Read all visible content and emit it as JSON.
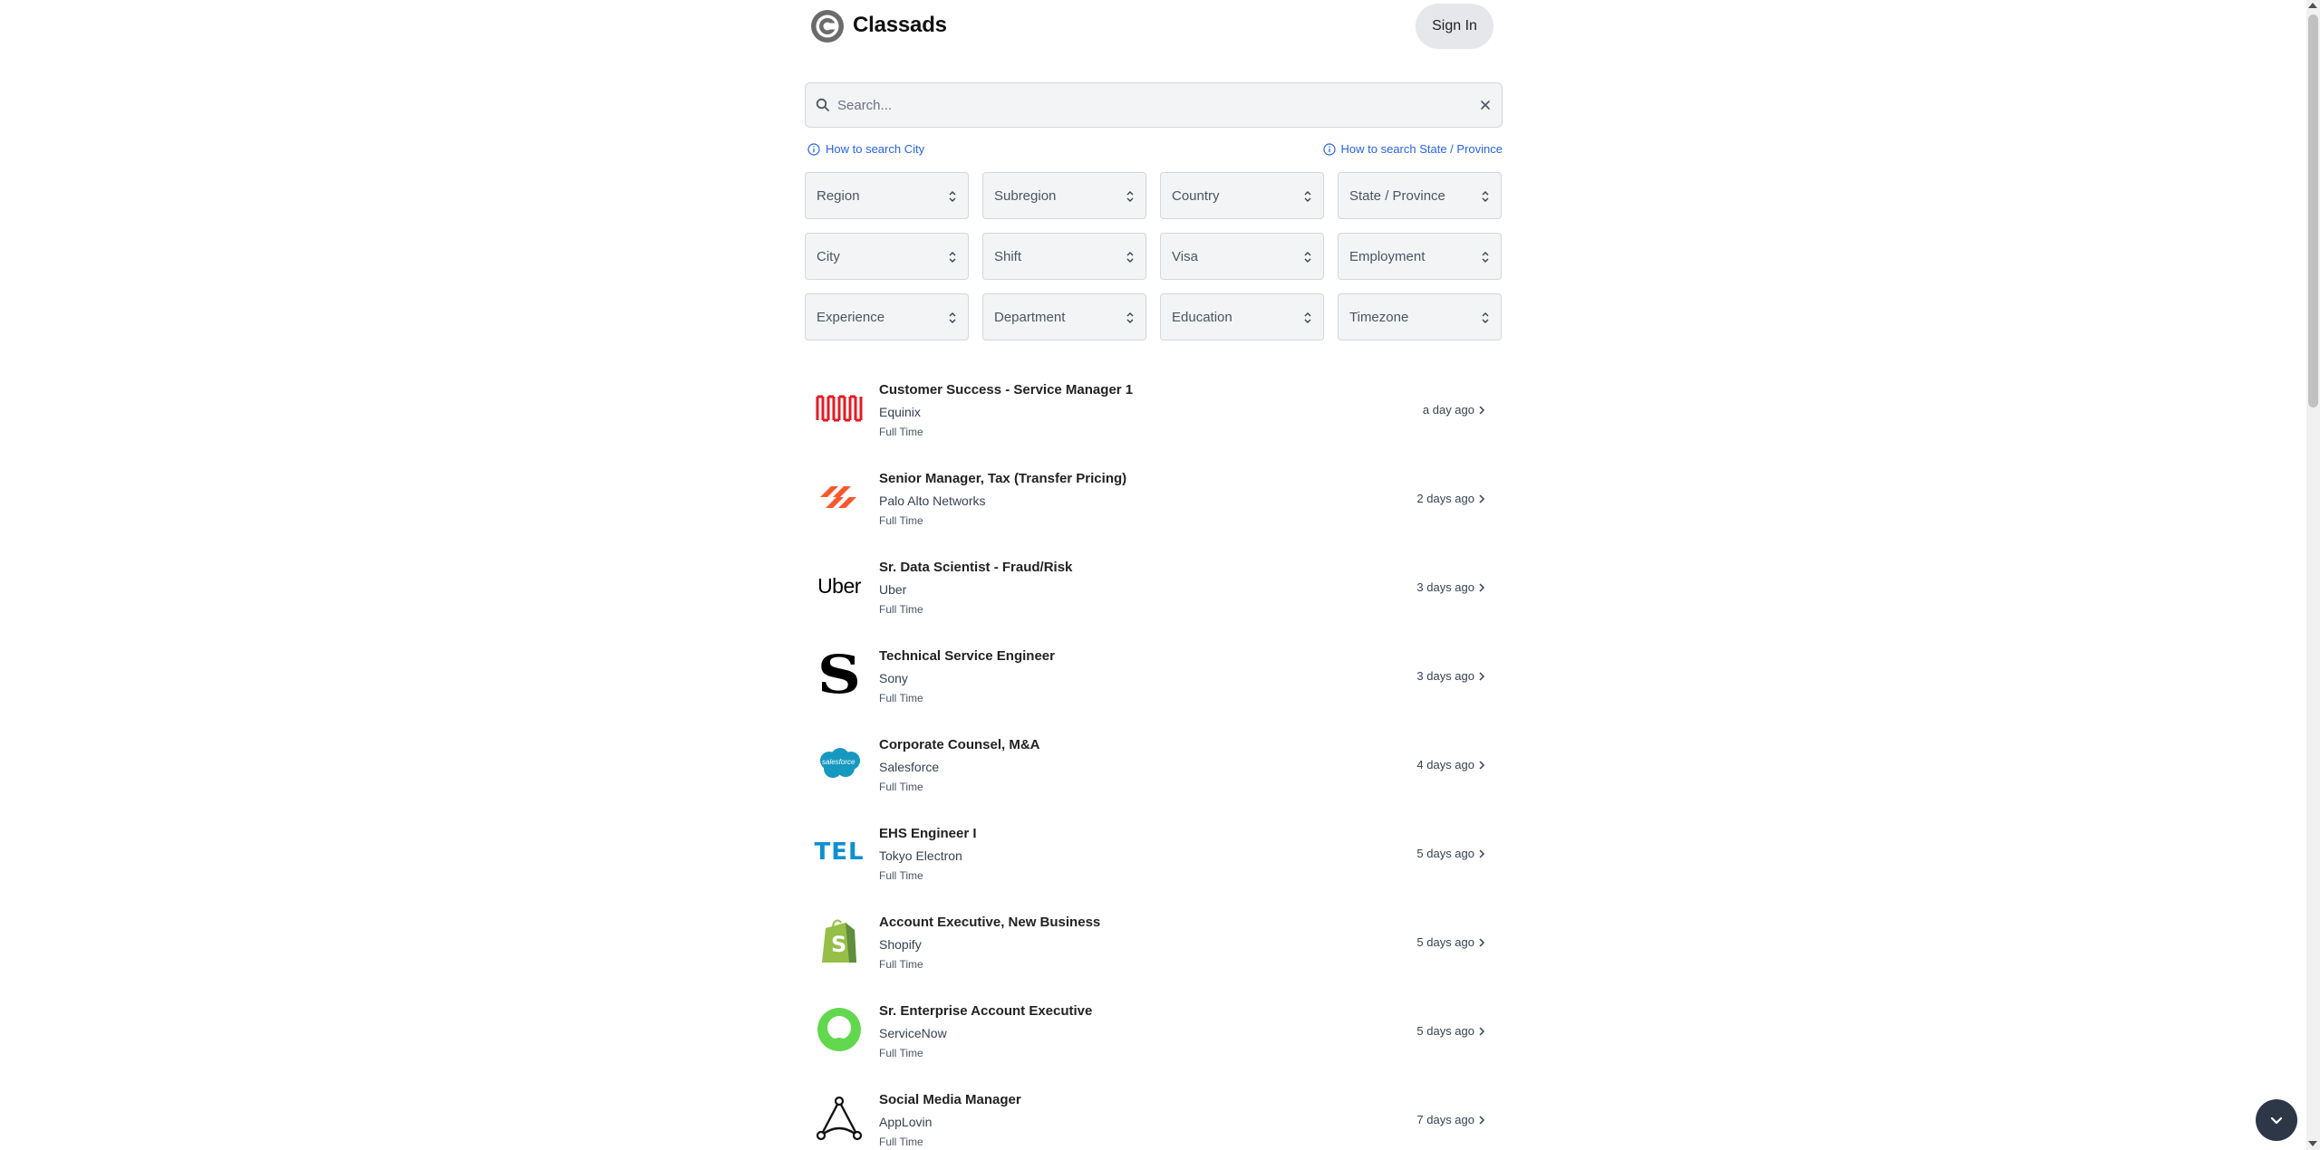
{
  "header": {
    "brand": "Classads",
    "sign_in_label": "Sign In"
  },
  "search": {
    "placeholder": "Search...",
    "value": ""
  },
  "help_links": {
    "city": "How to search City",
    "state": "How to search State / Province"
  },
  "filters": [
    "Region",
    "Subregion",
    "Country",
    "State / Province",
    "City",
    "Shift",
    "Visa",
    "Employment",
    "Experience",
    "Department",
    "Education",
    "Timezone"
  ],
  "jobs": [
    {
      "title": "Customer Success - Service Manager 1",
      "company": "Equinix",
      "type": "Full Time",
      "posted": "a day ago",
      "logo": "equinix-logo"
    },
    {
      "title": "Senior Manager, Tax (Transfer Pricing)",
      "company": "Palo Alto Networks",
      "type": "Full Time",
      "posted": "2 days ago",
      "logo": "palo-alto-logo"
    },
    {
      "title": "Sr. Data Scientist - Fraud/Risk",
      "company": "Uber",
      "type": "Full Time",
      "posted": "3 days ago",
      "logo": "uber-logo",
      "logo_text": "Uber"
    },
    {
      "title": "Technical Service Engineer",
      "company": "Sony",
      "type": "Full Time",
      "posted": "3 days ago",
      "logo": "sony-logo",
      "logo_text": "S"
    },
    {
      "title": "Corporate Counsel, M&A",
      "company": "Salesforce",
      "type": "Full Time",
      "posted": "4 days ago",
      "logo": "salesforce-logo",
      "logo_text": "salesforce"
    },
    {
      "title": "EHS Engineer I",
      "company": "Tokyo Electron",
      "type": "Full Time",
      "posted": "5 days ago",
      "logo": "tel-logo",
      "logo_text": "TEL"
    },
    {
      "title": "Account Executive, New Business",
      "company": "Shopify",
      "type": "Full Time",
      "posted": "5 days ago",
      "logo": "shopify-logo",
      "logo_text": "S"
    },
    {
      "title": "Sr. Enterprise Account Executive",
      "company": "ServiceNow",
      "type": "Full Time",
      "posted": "5 days ago",
      "logo": "servicenow-logo"
    },
    {
      "title": "Social Media Manager",
      "company": "AppLovin",
      "type": "Full Time",
      "posted": "7 days ago",
      "logo": "applovin-logo"
    }
  ],
  "colors": {
    "link": "#2563eb",
    "fab": "#2d3748",
    "equinix": "#e31b23",
    "palo_alto": "#fa582d",
    "salesforce": "#1798c1",
    "tel": "#0f8fd1",
    "shopify": "#95bf47",
    "servicenow": "#62d84e"
  }
}
